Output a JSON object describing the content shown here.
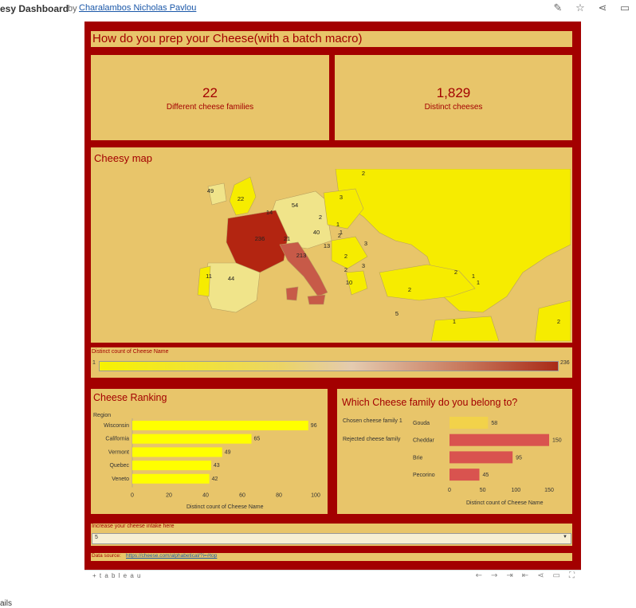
{
  "header": {
    "title": "esy Dashboard",
    "by": "by",
    "author": "Charalambos Nicholas Pavlou"
  },
  "dashboard": {
    "title": "How do you prep your Cheese(with a batch macro)",
    "kpis": [
      {
        "value": "22",
        "label": "Different cheese families"
      },
      {
        "value": "1,829",
        "label": "Distinct cheeses"
      }
    ],
    "map": {
      "title": "Cheesy  map",
      "labels": [
        "2",
        "49",
        "22",
        "14",
        "54",
        "3",
        "2",
        "1",
        "1",
        "40",
        "2",
        "236",
        "21",
        "13",
        "2",
        "3",
        "213",
        "2",
        "3",
        "11",
        "44",
        "1",
        "10",
        "2",
        "2",
        "1",
        "5",
        "1",
        "2"
      ]
    },
    "legend": {
      "title": "Distinct count of Cheese Name",
      "min": "1",
      "max": "236",
      "colors": {
        "low": "#f7f200",
        "high": "#a92a17"
      }
    },
    "ranking": {
      "title": "Cheese Ranking",
      "region_label": "Region",
      "xlabel": "Distinct count of Cheese Name"
    },
    "family": {
      "title": "Which Cheese family do you belong to?",
      "chosen_label": "Chosen cheese family 1",
      "rejected_label": "Rejected cheese family",
      "xlabel": "Distinct count of Cheese Name"
    },
    "intake": {
      "label": "Increase your cheese intake here",
      "value": "5"
    },
    "source": {
      "label": "Data source:",
      "link": "https://cheese.com/alphabetical/?i=#top"
    }
  },
  "toolbar": {
    "logo": "+ t a b l e a u"
  },
  "footer": {
    "details": "ails"
  },
  "colors": {
    "dark_red": "#a30000",
    "panel": "#e8c56a",
    "yellow": "#ffff00",
    "coral": "#d9534f",
    "gold": "#f2d24a"
  },
  "chart_data": [
    {
      "type": "bar",
      "title": "Cheese Ranking",
      "categories": [
        "Wisconsin",
        "California",
        "Vermont",
        "Quebec",
        "Veneto"
      ],
      "values": [
        96,
        65,
        49,
        43,
        42
      ],
      "xlabel": "Distinct count of Cheese Name",
      "ylabel": "Region",
      "xlim": [
        0,
        100
      ],
      "ticks": [
        0,
        20,
        40,
        60,
        80,
        100
      ]
    },
    {
      "type": "bar",
      "title": "Which Cheese family do you belong to?",
      "categories": [
        "Gouda",
        "Cheddar",
        "Brie",
        "Pecorino"
      ],
      "values": [
        58,
        150,
        95,
        45
      ],
      "groups": [
        "Chosen cheese family 1",
        "Rejected cheese family",
        "Rejected cheese family",
        "Rejected cheese family"
      ],
      "xlabel": "Distinct count of Cheese Name",
      "xlim": [
        0,
        150
      ],
      "ticks": [
        0,
        50,
        100,
        150
      ]
    }
  ]
}
